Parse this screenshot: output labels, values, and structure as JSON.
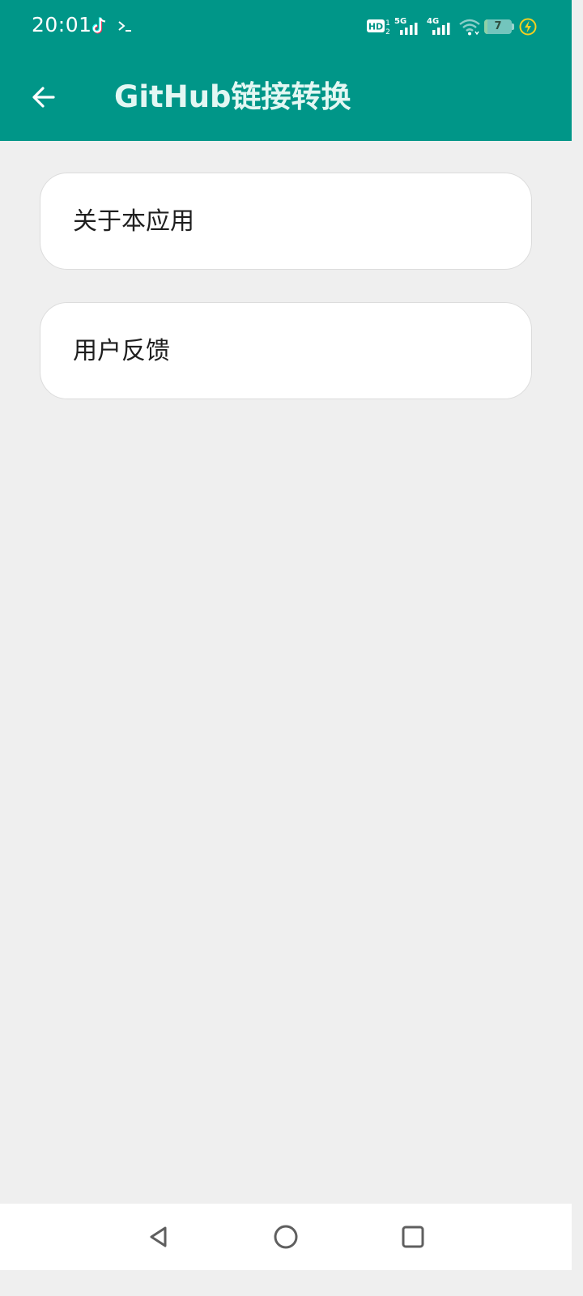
{
  "status_bar": {
    "time": "20:01",
    "network_1": "5G",
    "network_2": "4G",
    "battery_level": 7,
    "battery_text": "7",
    "icons": [
      "tiktok-icon",
      "terminal-icon",
      "hd-icon",
      "signal-5g-icon",
      "signal-4g-icon",
      "wifi-icon",
      "battery-icon",
      "charging-icon"
    ]
  },
  "app_bar": {
    "back_icon": "arrow-left-icon",
    "title": "GitHub链接转换"
  },
  "menu": {
    "items": [
      {
        "label": "关于本应用"
      },
      {
        "label": "用户反馈"
      }
    ]
  },
  "nav_bar": {
    "icons": [
      "nav-back-icon",
      "nav-home-icon",
      "nav-recents-icon"
    ]
  },
  "colors": {
    "primary": "#009688",
    "title_text": "#e3f7f3",
    "background": "#efefef",
    "card": "#ffffff",
    "charging": "#f5d020"
  }
}
